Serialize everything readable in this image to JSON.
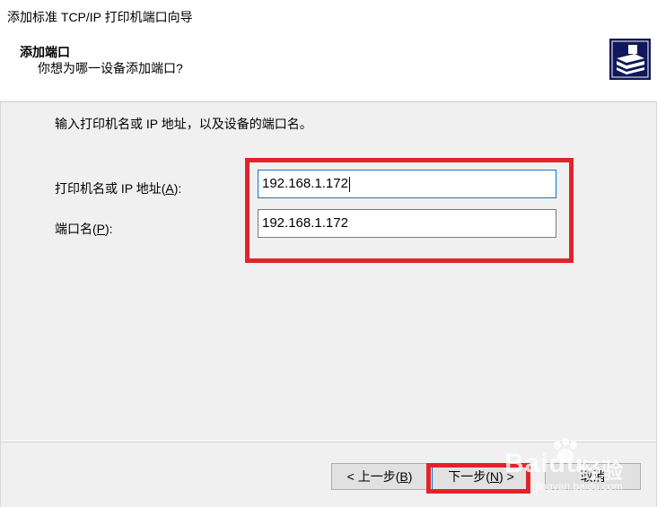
{
  "window": {
    "title": "添加标准 TCP/IP 打印机端口向导"
  },
  "header": {
    "title": "添加端口",
    "subtitle": "你想为哪一设备添加端口?",
    "icon": "printer-wizard-icon"
  },
  "content": {
    "instruction": "输入打印机名或 IP 地址，以及设备的端口名。",
    "printer_name_label_prefix": "打印机名或 IP 地址(",
    "printer_name_label_key": "A",
    "printer_name_label_suffix": "):",
    "printer_name_value": "192.168.1.172",
    "port_name_label_prefix": "端口名(",
    "port_name_label_key": "P",
    "port_name_label_suffix": "):",
    "port_name_value": "192.168.1.172"
  },
  "buttons": {
    "back_prefix": "< 上一步(",
    "back_key": "B",
    "back_suffix": ")",
    "next_prefix": "下一步(",
    "next_key": "N",
    "next_suffix": ") >",
    "cancel": "取消"
  },
  "colors": {
    "highlight": "#e1242a",
    "focus_border": "#0078d7",
    "panel_bg": "#f0f0f0",
    "icon_bg": "#10175a"
  },
  "watermark": {
    "logo": "Baidu",
    "text": "经验",
    "url": "jingyan.baidu.com"
  }
}
